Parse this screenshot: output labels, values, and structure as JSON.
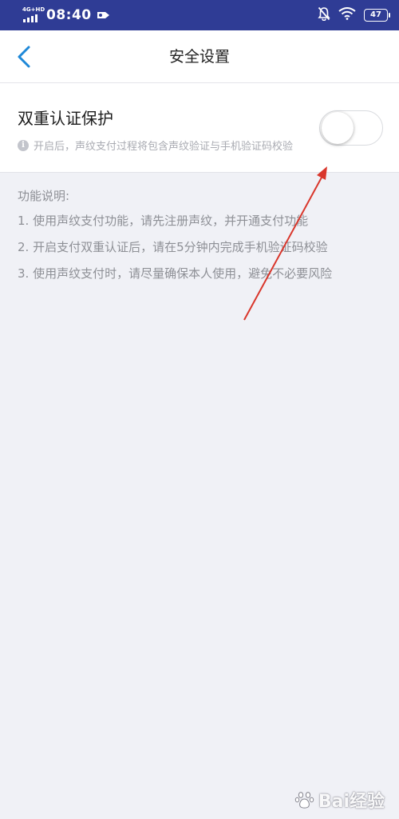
{
  "status_bar": {
    "network": "4G+HD",
    "time": "08:40",
    "battery": "47",
    "icons": [
      "signal-icon",
      "cast-icon",
      "mute-bell-icon",
      "wifi-icon",
      "battery-icon"
    ]
  },
  "header": {
    "title": "安全设置",
    "back_icon": "chevron-left-icon"
  },
  "setting": {
    "title": "双重认证保护",
    "description": "开启后，声纹支付过程将包含声纹验证与手机验证码校验",
    "info_icon_glyph": "i",
    "toggle_on": false
  },
  "info": {
    "heading": "功能说明:",
    "items": [
      "1. 使用声纹支付功能，请先注册声纹，并开通支付功能",
      "2. 开启支付双重认证后，请在5分钟内完成手机验证码校验",
      "3. 使用声纹支付时，请尽量确保本人使用，避免不必要风险"
    ]
  },
  "watermark": {
    "text": "Bai经验"
  },
  "colors": {
    "status_bar": "#2f3c95",
    "accent": "#1e88d8",
    "annotation": "#d9362b",
    "background": "#f0f1f6"
  }
}
